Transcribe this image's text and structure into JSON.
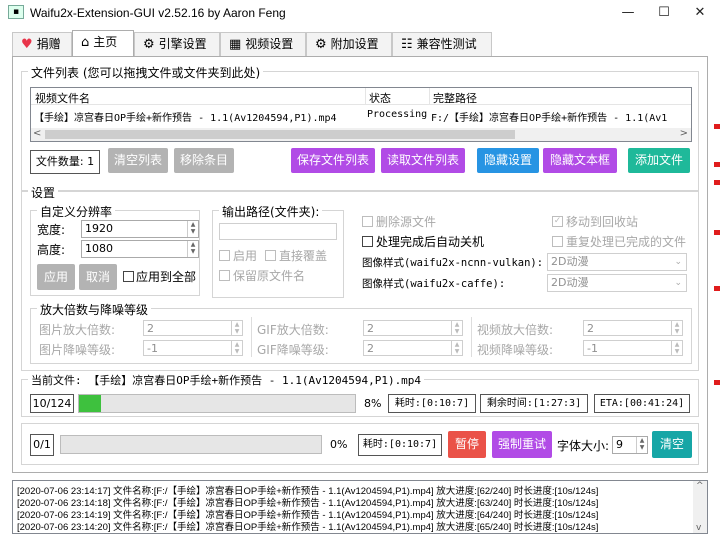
{
  "window": {
    "title": "Waifu2x-Extension-GUI v2.52.16 by Aaron Feng",
    "minimize": "—",
    "maximize": "☐",
    "close": "✕"
  },
  "tabs": [
    {
      "label": "捐赠",
      "icon": "heart-icon",
      "glyph": "♥"
    },
    {
      "label": "主页",
      "icon": "home-icon",
      "glyph": "⌂"
    },
    {
      "label": "引擎设置",
      "icon": "engine-icon",
      "glyph": "⚙"
    },
    {
      "label": "视频设置",
      "icon": "clapperboard-icon",
      "glyph": "▦"
    },
    {
      "label": "附加设置",
      "icon": "gear-icon",
      "glyph": "⚙"
    },
    {
      "label": "兼容性测试",
      "icon": "checklist-icon",
      "glyph": "☷"
    }
  ],
  "file_list": {
    "legend": "文件列表 (您可以拖拽文件或文件夹到此处)",
    "columns": [
      "视频文件名",
      "状态",
      "完整路径"
    ],
    "rows": [
      {
        "name": "【手绘】凉宫春日OP手绘+新作预告 - 1.1(Av1204594,P1).mp4",
        "status": "Processing",
        "path": "F:/【手绘】凉宫春日OP手绘+新作预告 - 1.1(Av1"
      }
    ],
    "scroll_left": "<",
    "scroll_right": ">"
  },
  "file_toolbar": {
    "count_label": "文件数量: 1",
    "clear_list": "清空列表",
    "remove_item": "移除条目",
    "save_list": "保存文件列表",
    "load_list": "读取文件列表",
    "hide_settings": "隐藏设置",
    "hide_textbox": "隐藏文本框",
    "add_file": "添加文件"
  },
  "settings": {
    "legend": "设置",
    "custom_res": {
      "legend": "自定义分辨率",
      "width_label": "宽度:",
      "width_value": "1920",
      "height_label": "高度:",
      "height_value": "1080",
      "apply": "应用",
      "cancel": "取消",
      "apply_all": "应用到全部"
    },
    "output": {
      "legend": "输出路径(文件夹):",
      "enable": "启用",
      "overwrite": "直接覆盖",
      "keep_name": "保留原文件名"
    },
    "options": {
      "delete_source": "删除源文件",
      "move_to_recycle": "移动到回收站",
      "shutdown": "处理完成后自动关机",
      "reprocess": "重复处理已完成的文件",
      "style_ncnn_label": "图像样式(waifu2x-ncnn-vulkan):",
      "style_ncnn_value": "2D动漫",
      "style_caffe_label": "图像样式(waifu2x-caffe):",
      "style_caffe_value": "2D动漫"
    },
    "scale": {
      "legend": "放大倍数与降噪等级",
      "img_scale_label": "图片放大倍数:",
      "img_scale_value": "2",
      "img_denoise_label": "图片降噪等级:",
      "img_denoise_value": "-1",
      "gif_scale_label": "GIF放大倍数:",
      "gif_scale_value": "2",
      "gif_denoise_label": "GIF降噪等级:",
      "gif_denoise_value": "2",
      "vid_scale_label": "视频放大倍数:",
      "vid_scale_value": "2",
      "vid_denoise_label": "视频降噪等级:",
      "vid_denoise_value": "-1"
    }
  },
  "progress": {
    "legend": "当前文件: 【手绘】凉宫春日OP手绘+新作预告 - 1.1(Av1204594,P1).mp4",
    "file_counter": "10/124",
    "file_percent_text": "8%",
    "file_fraction": 0.08,
    "elapsed": "耗时:[0:10:7]",
    "remaining": "剩余时间:[1:27:3]",
    "eta": "ETA:[00:41:24]",
    "total_counter": "0/1",
    "total_percent_text": "0%",
    "total_fraction": 0.0,
    "total_elapsed": "耗时:[0:10:7]",
    "pause": "暂停",
    "force_retry": "强制重试",
    "font_size_label": "字体大小:",
    "font_size_value": "9",
    "clear": "清空"
  },
  "log": [
    "[2020-07-06 23:14:17] 文件名称:[F:/【手绘】凉宫春日OP手绘+新作预告 - 1.1(Av1204594,P1).mp4] 放大进度:[62/240] 时长进度:[10s/124s]",
    "[2020-07-06 23:14:18] 文件名称:[F:/【手绘】凉宫春日OP手绘+新作预告 - 1.1(Av1204594,P1).mp4] 放大进度:[63/240] 时长进度:[10s/124s]",
    "[2020-07-06 23:14:19] 文件名称:[F:/【手绘】凉宫春日OP手绘+新作预告 - 1.1(Av1204594,P1).mp4] 放大进度:[64/240] 时长进度:[10s/124s]",
    "[2020-07-06 23:14:20] 文件名称:[F:/【手绘】凉宫春日OP手绘+新作预告 - 1.1(Av1204594,P1).mp4] 放大进度:[65/240] 时长进度:[10s/124s]"
  ],
  "log_scroll_up": "^",
  "log_scroll_down": "v",
  "colors": {
    "progress_fill": "#3ec13e",
    "accent_purple": "#b14be6",
    "accent_blue": "#2794e3",
    "accent_teal": "#1fb99a",
    "accent_red": "#ea5248"
  }
}
